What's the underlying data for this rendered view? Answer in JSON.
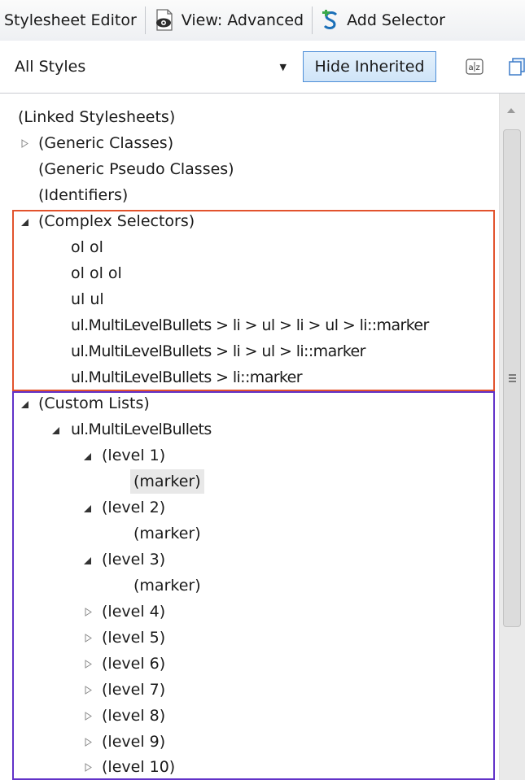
{
  "toolbar": {
    "title": "Stylesheet Editor",
    "view_label": "View: Advanced",
    "add_selector_label": "Add Selector",
    "view_icon": "eye-document-icon",
    "add_icon": "add-selector-icon"
  },
  "filter": {
    "selected": "All Styles",
    "hide_inherited_label": "Hide Inherited",
    "sort_icon": "sort-alphabetical-icon"
  },
  "tree": {
    "linked": "(Linked Stylesheets)",
    "generic_classes": "(Generic Classes)",
    "generic_pseudo": "(Generic Pseudo Classes)",
    "identifiers": "(Identifiers)",
    "complex": "(Complex Selectors)",
    "complex_items": [
      "ol ol",
      "ol ol ol",
      "ul ul",
      "ul.MultiLevelBullets > li > ul > li > ul > li::marker",
      "ul.MultiLevelBullets > li > ul > li::marker",
      "ul.MultiLevelBullets > li::marker"
    ],
    "custom": "(Custom Lists)",
    "multilevel": "ul.MultiLevelBullets",
    "levels": [
      "(level 1)",
      "(level 2)",
      "(level 3)",
      "(level 4)",
      "(level 5)",
      "(level 6)",
      "(level 7)",
      "(level 8)",
      "(level 9)",
      "(level 10)"
    ],
    "marker": "(marker)"
  },
  "colors": {
    "complex_highlight": "#e2532d",
    "custom_highlight": "#6232c8",
    "button_accent": "#4d8ed8"
  }
}
